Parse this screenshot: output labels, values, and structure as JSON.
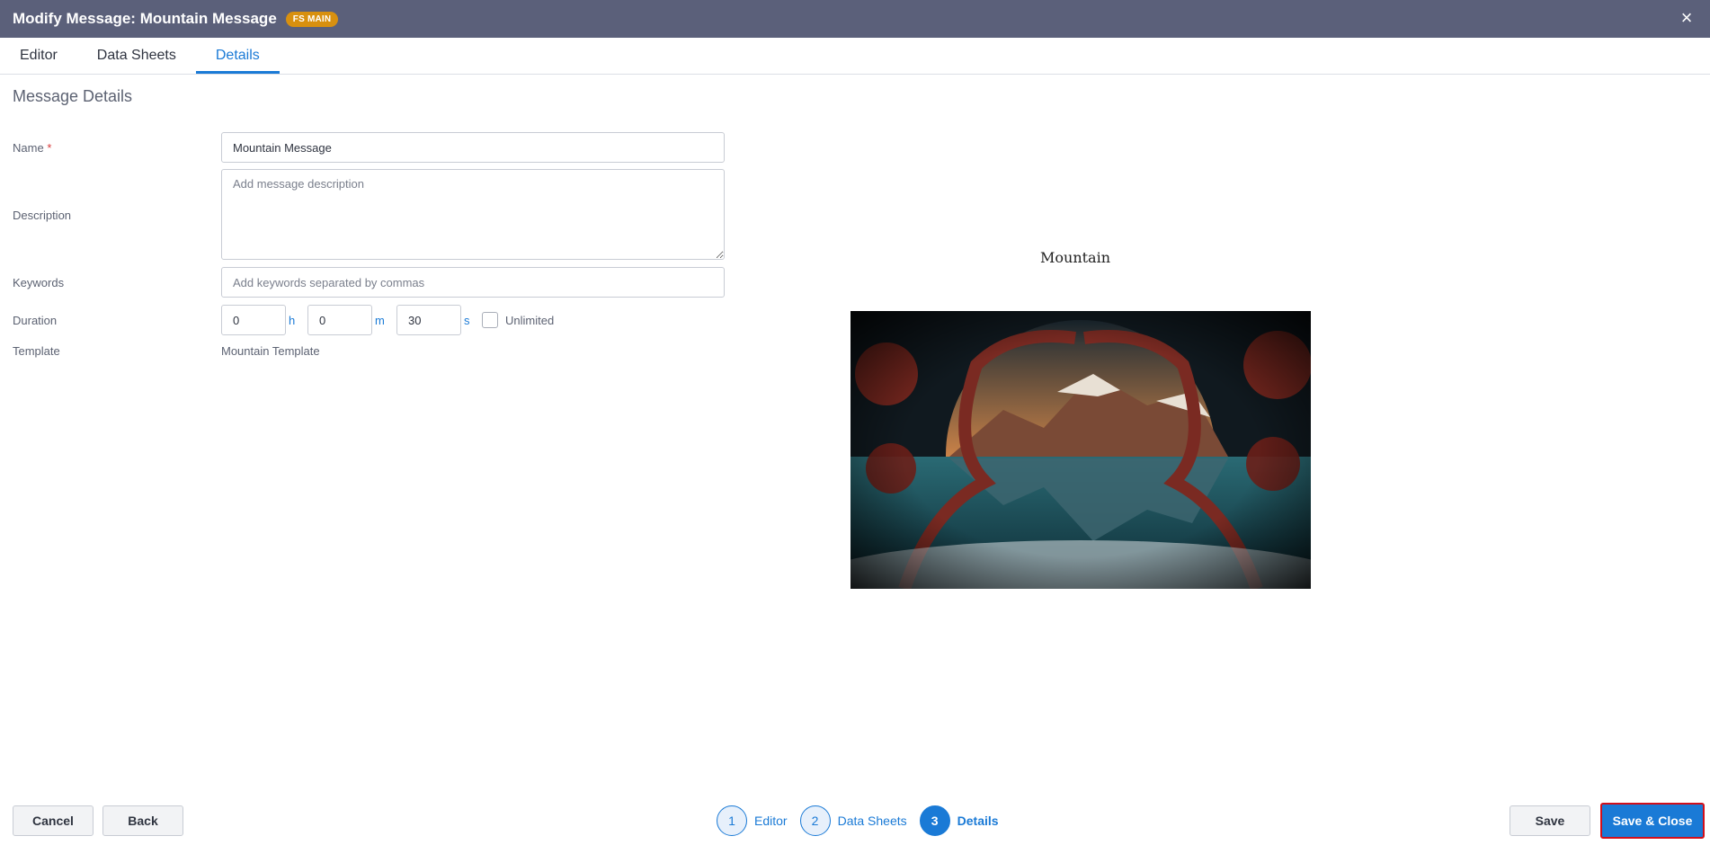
{
  "window": {
    "title": "Modify Message: Mountain Message",
    "badge": "FS MAIN",
    "close_icon": "×"
  },
  "tabs": [
    {
      "label": "Editor",
      "active": false
    },
    {
      "label": "Data Sheets",
      "active": false
    },
    {
      "label": "Details",
      "active": true
    }
  ],
  "details": {
    "section_title": "Message Details",
    "name": {
      "label": "Name",
      "required_mark": "*",
      "value": "Mountain Message"
    },
    "description": {
      "label": "Description",
      "value": "",
      "placeholder": "Add message description"
    },
    "keywords": {
      "label": "Keywords",
      "value": "",
      "placeholder": "Add keywords separated by commas"
    },
    "duration": {
      "label": "Duration",
      "hours": "0",
      "hours_unit": "h",
      "minutes": "0",
      "minutes_unit": "m",
      "seconds": "30",
      "seconds_unit": "s",
      "unlimited_label": "Unlimited",
      "unlimited_checked": false
    },
    "template": {
      "label": "Template",
      "value": "Mountain Template"
    }
  },
  "preview": {
    "title": "Mountain",
    "image_icon": "mountain-landscape-image"
  },
  "footer": {
    "cancel_label": "Cancel",
    "back_label": "Back",
    "save_label": "Save",
    "save_close_label": "Save & Close",
    "steps": [
      {
        "number": "1",
        "label": "Editor",
        "active": false
      },
      {
        "number": "2",
        "label": "Data Sheets",
        "active": false
      },
      {
        "number": "3",
        "label": "Details",
        "active": true
      }
    ]
  },
  "colors": {
    "header_bg": "#5b607a",
    "badge_bg": "#d8900f",
    "accent": "#1a7ad6",
    "highlight_border": "#d10f1b"
  }
}
